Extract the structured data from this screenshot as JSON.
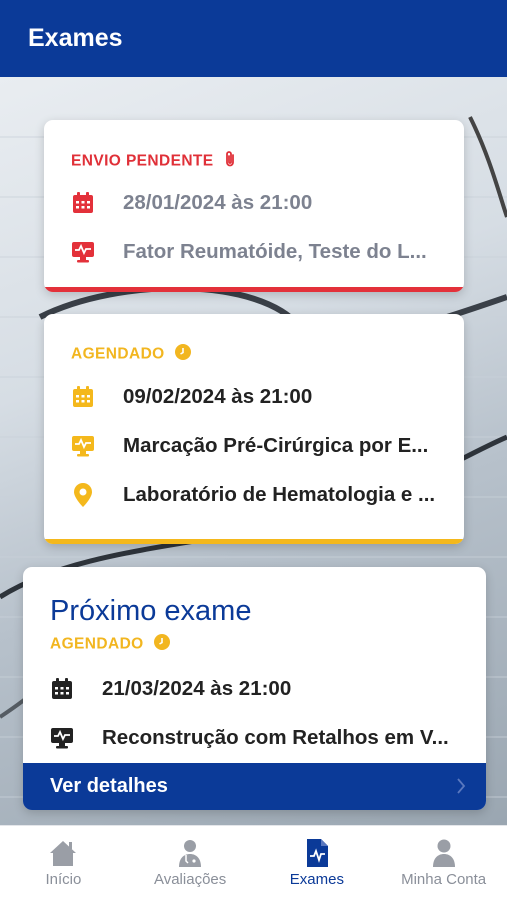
{
  "header": {
    "title": "Exames"
  },
  "exams": [
    {
      "status": "ENVIO PENDENTE",
      "status_icon": "paperclip-icon",
      "status_color": "#e03038",
      "datetime": "28/01/2024 às 21:00",
      "exam_name": "Fator Reumatóide, Teste do L..."
    },
    {
      "status": "AGENDADO",
      "status_icon": "clock-icon",
      "status_color": "#f2b620",
      "datetime": "09/02/2024 às 21:00",
      "exam_name": "Marcação Pré-Cirúrgica por E...",
      "location": "Laboratório de Hematologia e ..."
    }
  ],
  "next_exam": {
    "heading": "Próximo exame",
    "status": "AGENDADO",
    "status_icon": "clock-icon",
    "datetime": "21/03/2024 às 21:00",
    "exam_name": "Reconstrução com Retalhos em V...",
    "details_label": "Ver detalhes"
  },
  "tabbar": {
    "active": "Exames",
    "items": [
      {
        "label": "Início",
        "icon": "home-icon"
      },
      {
        "label": "Avaliações",
        "icon": "doctor-icon"
      },
      {
        "label": "Exames",
        "icon": "exam-file-icon"
      },
      {
        "label": "Minha Conta",
        "icon": "user-icon"
      }
    ]
  },
  "colors": {
    "primary": "#0b3a98",
    "pending": "#e3313a",
    "scheduled": "#f4b81c"
  }
}
